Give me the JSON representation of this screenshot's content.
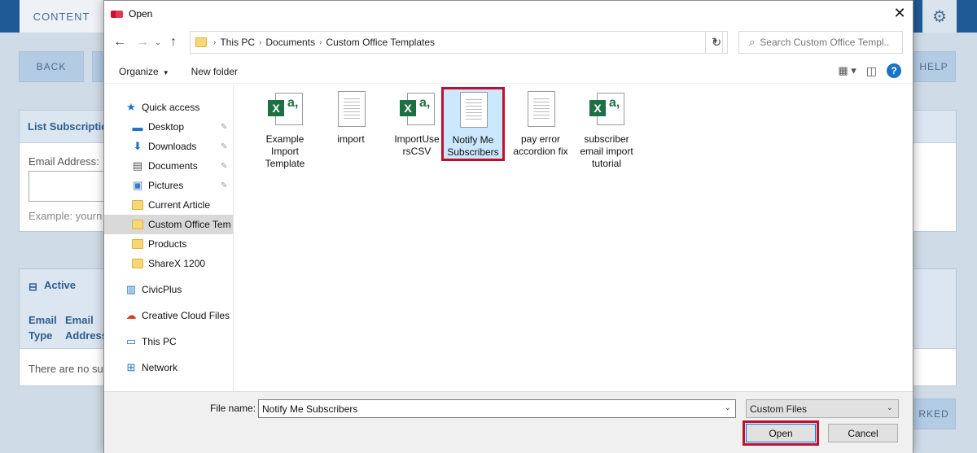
{
  "background": {
    "tab_label": "CONTENT",
    "back_button": "BACK",
    "help_button": "HELP",
    "marked_button": "RKED",
    "panel1_title": "List Subscriptio",
    "email_label": "Email Address:",
    "example_text": "Example: yourn",
    "panel2_title": "Active",
    "col_email_type": "Email Type",
    "col_email_address": "Email Address",
    "empty_text": "There are no su"
  },
  "dialog": {
    "title": "Open",
    "address": {
      "crumbs": [
        "This PC",
        "Documents",
        "Custom Office Templates"
      ]
    },
    "search_placeholder": "Search Custom Office Templ...",
    "toolbar": {
      "organize": "Organize",
      "new_folder": "New folder"
    },
    "nav": [
      {
        "label": "Quick access",
        "icon": "star-icon",
        "indent": false,
        "pinned": false
      },
      {
        "label": "Desktop",
        "icon": "desktop-icon",
        "indent": true,
        "pinned": true
      },
      {
        "label": "Downloads",
        "icon": "download-icon",
        "indent": true,
        "pinned": true
      },
      {
        "label": "Documents",
        "icon": "documents-icon",
        "indent": true,
        "pinned": true
      },
      {
        "label": "Pictures",
        "icon": "pictures-icon",
        "indent": true,
        "pinned": true
      },
      {
        "label": "Current Article",
        "icon": "folder-icon",
        "indent": true,
        "pinned": false
      },
      {
        "label": "Custom Office Tem",
        "icon": "folder-icon",
        "indent": true,
        "pinned": false,
        "selected": true
      },
      {
        "label": "Products",
        "icon": "folder-icon",
        "indent": true,
        "pinned": false
      },
      {
        "label": "ShareX 1200",
        "icon": "folder-icon",
        "indent": true,
        "pinned": false
      },
      {
        "label": "CivicPlus",
        "icon": "building-icon",
        "indent": false,
        "pinned": false
      },
      {
        "label": "Creative Cloud Files",
        "icon": "creative-cloud-icon",
        "indent": false,
        "pinned": false
      },
      {
        "label": "This PC",
        "icon": "computer-icon",
        "indent": false,
        "pinned": false
      },
      {
        "label": "Network",
        "icon": "network-icon",
        "indent": false,
        "pinned": false
      }
    ],
    "files": [
      {
        "name": "Example Import Template",
        "type": "excel"
      },
      {
        "name": "import",
        "type": "text"
      },
      {
        "name": "ImportUsersCSV",
        "type": "excel"
      },
      {
        "name": "Notify Me Subscribers",
        "type": "text",
        "selected": true
      },
      {
        "name": "pay error accordion fix",
        "type": "text"
      },
      {
        "name": "subscriber email import tutorial",
        "type": "excel"
      }
    ],
    "file_name_label": "File name:",
    "file_name_value": "Notify Me Subscribers",
    "file_type": "Custom Files",
    "open_button": "Open",
    "cancel_button": "Cancel",
    "colors": {
      "accent": "#0078d7",
      "highlight": "#c01030",
      "selection": "#cce8ff"
    }
  }
}
